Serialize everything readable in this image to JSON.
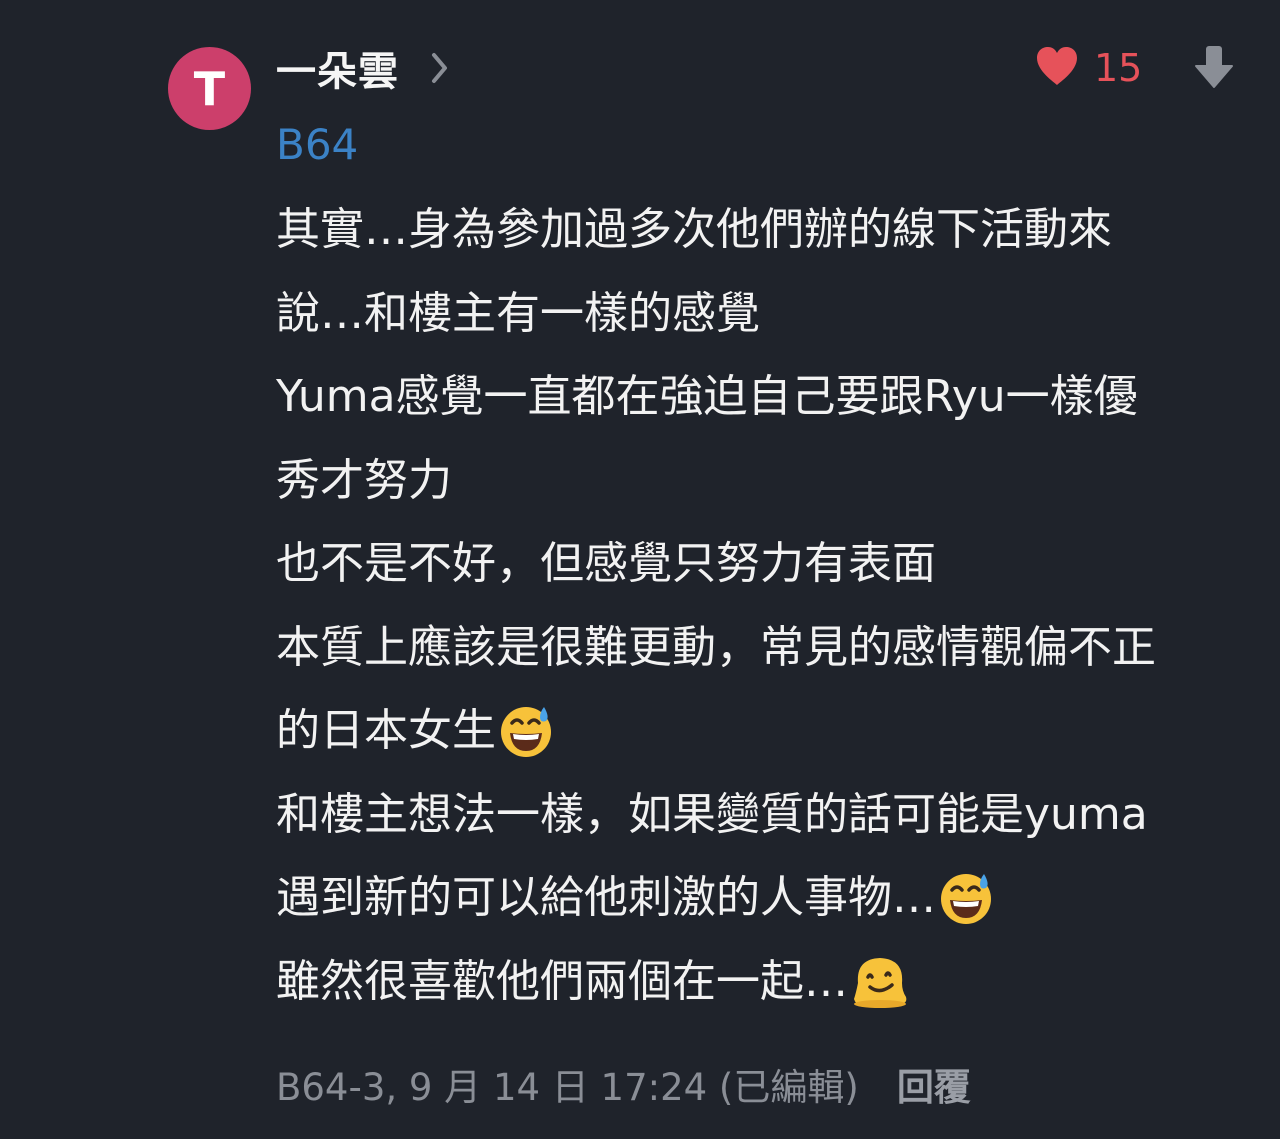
{
  "comment": {
    "avatar_initial": "T",
    "avatar_color": "#cc3f6b",
    "author": "一朵雲",
    "floor": "B64",
    "likes": "15",
    "like_color": "#e6525a",
    "icons": {
      "chevron": "chevron-right-icon",
      "heart": "heart-icon",
      "downvote": "arrow-down-icon"
    },
    "lines": [
      "其實…身為參加過多次他們辦的線下活動來",
      "說…和樓主有一樣的感覺",
      "Yuma感覺一直都在強迫自己要跟Ryu一樣優",
      "秀才努力",
      "也不是不好，但感覺只努力有表面",
      "本質上應該是很難更動，常見的感情觀偏不正",
      "的日本女生",
      "和樓主想法一樣，如果變質的話可能是yuma",
      "遇到新的可以給他刺激的人事物…",
      "雖然很喜歡他們兩個在一起…"
    ],
    "emojis": {
      "line6": "grinning-face-with-sweat",
      "line8": "grinning-face-with-sweat",
      "line9": "melting-face"
    },
    "footer": "B64-3, 9 月 14 日 17:24 (已編輯)",
    "reply_label": "回覆"
  }
}
